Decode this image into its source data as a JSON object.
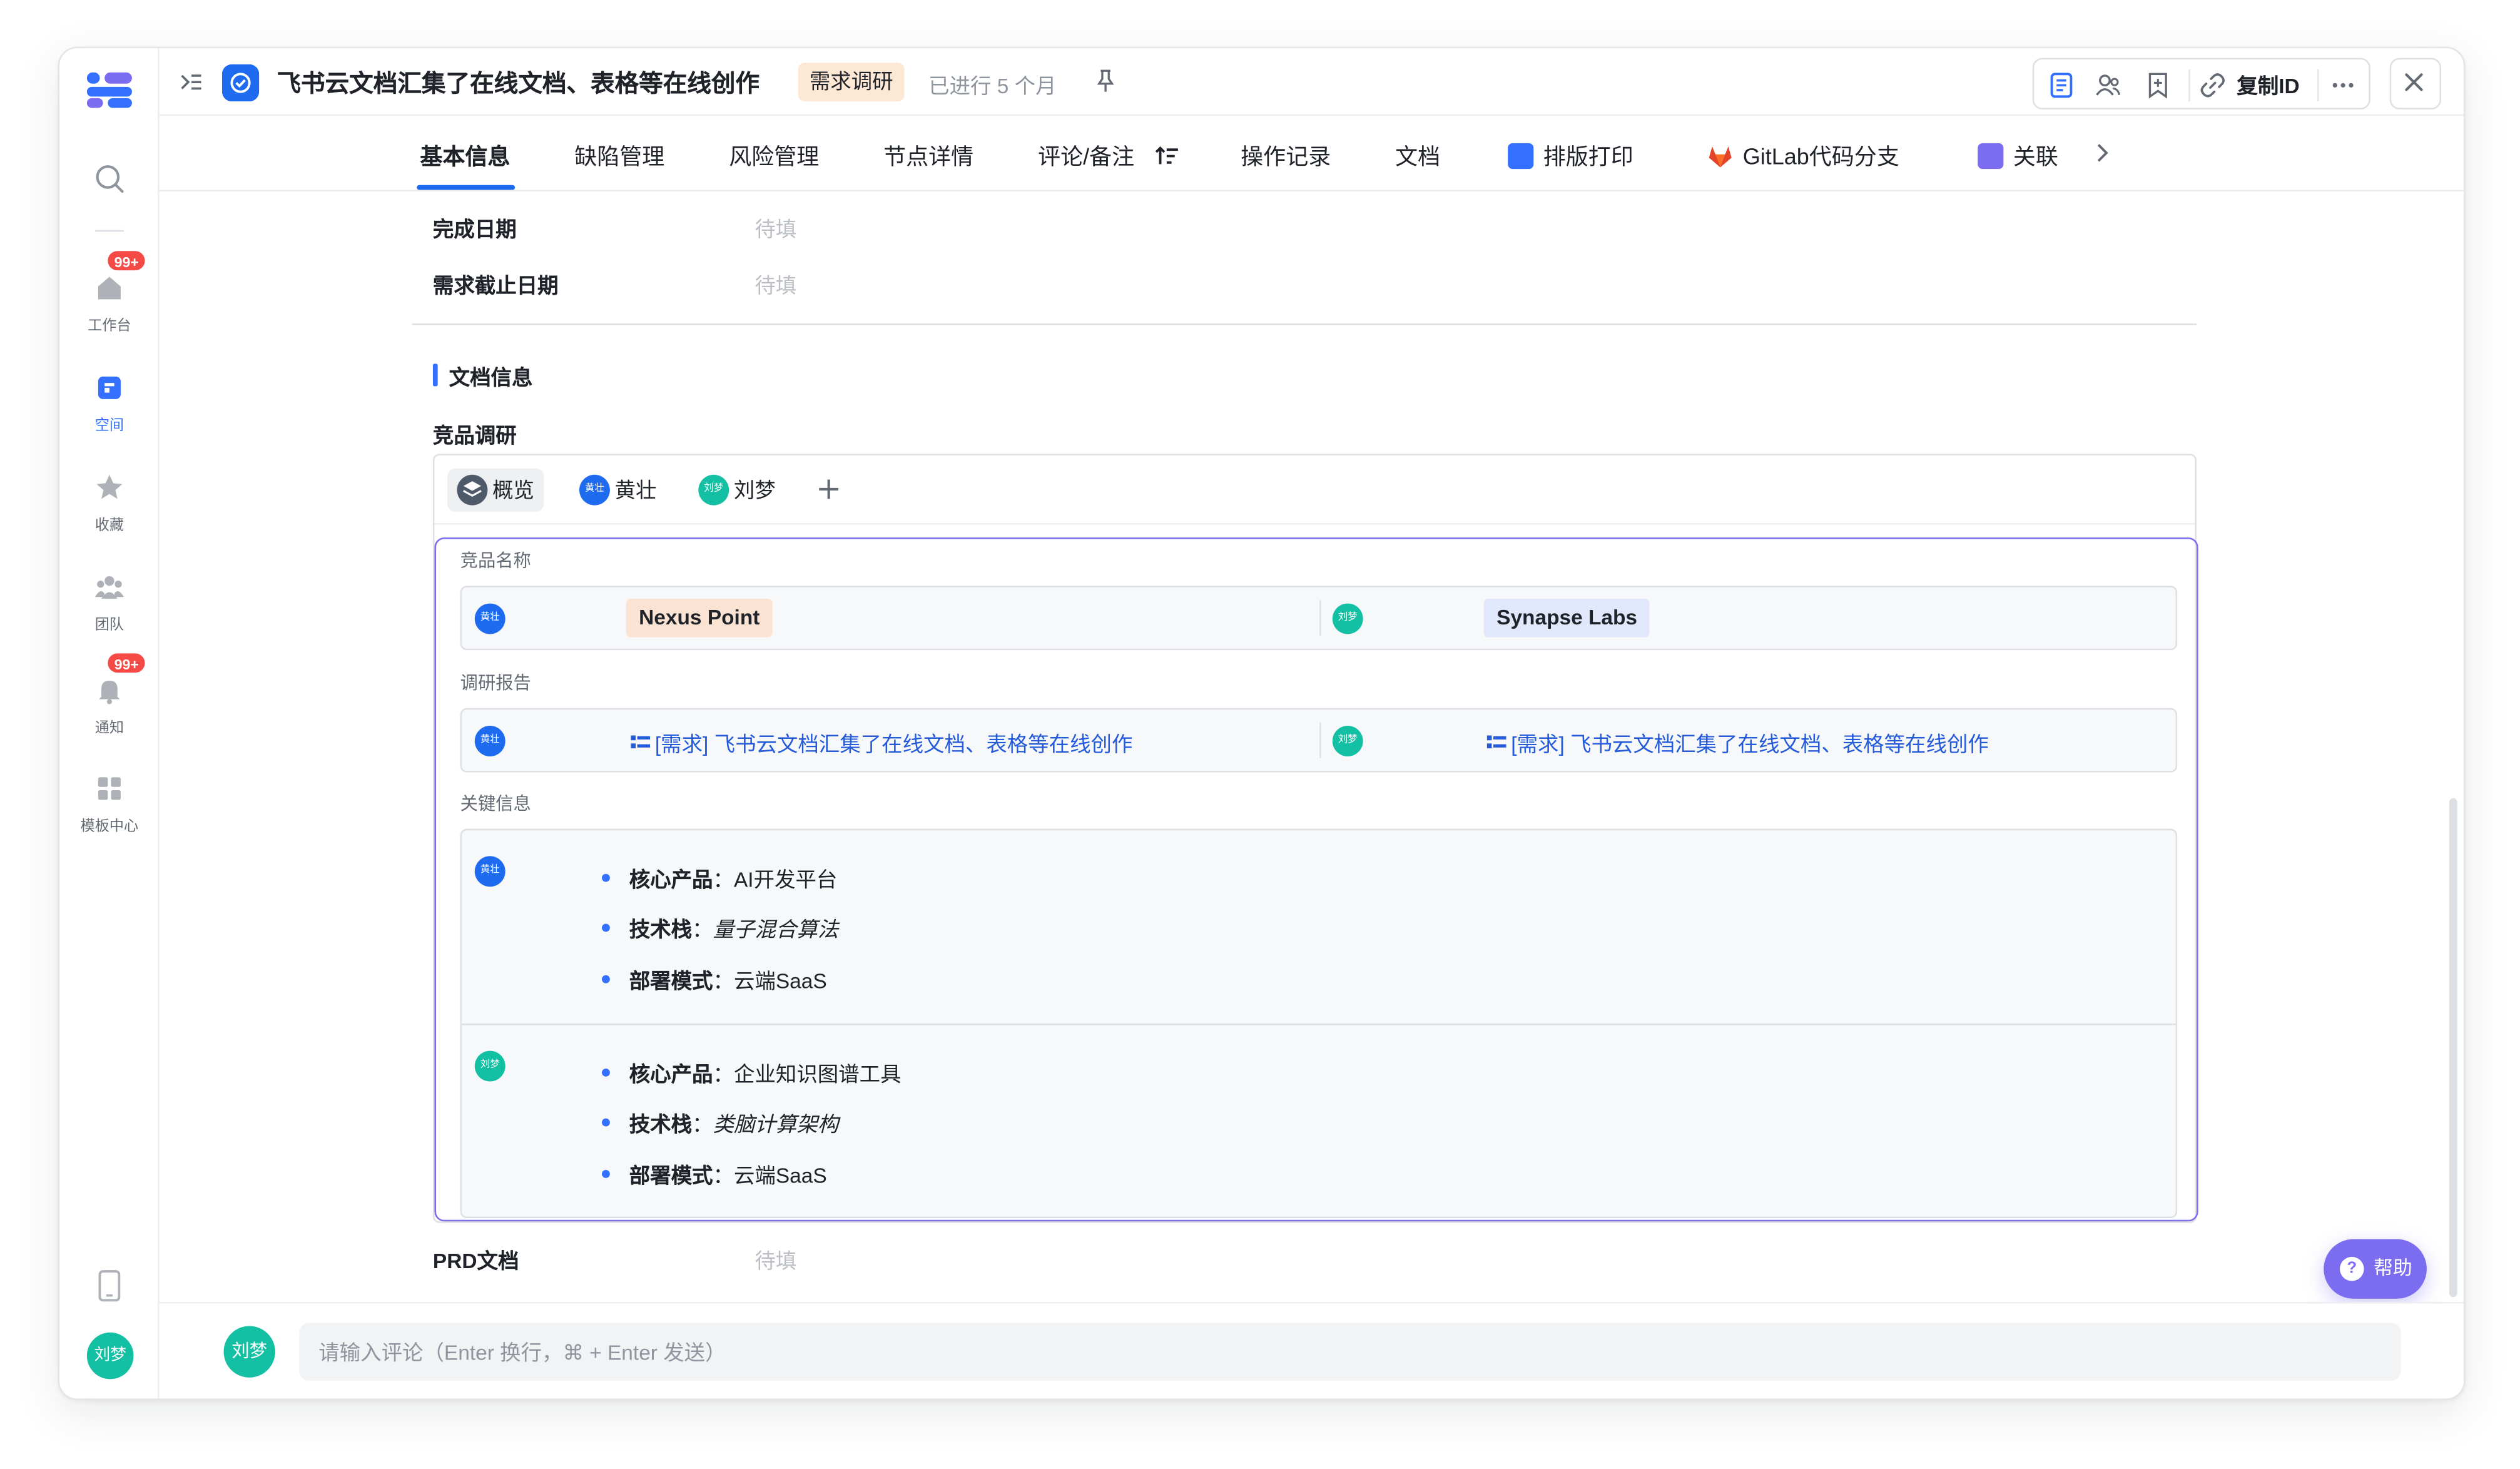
{
  "sidebar": {
    "items": [
      {
        "label": "工作台",
        "badge": "99+"
      },
      {
        "label": "空间"
      },
      {
        "label": "收藏"
      },
      {
        "label": "团队"
      },
      {
        "label": "通知",
        "badge": "99+"
      },
      {
        "label": "模板中心"
      }
    ],
    "user_avatar": "刘梦"
  },
  "header": {
    "title": "飞书云文档汇集了在线文档、表格等在线创作",
    "tag": "需求调研",
    "elapsed": "已进行 5 个月",
    "copy_id": "复制ID"
  },
  "tabs": [
    {
      "label": "基本信息"
    },
    {
      "label": "缺陷管理"
    },
    {
      "label": "风险管理"
    },
    {
      "label": "节点详情"
    },
    {
      "label": "评论/备注"
    },
    {
      "label": "操作记录"
    },
    {
      "label": "文档"
    },
    {
      "label": "排版打印"
    },
    {
      "label": "GitLab代码分支"
    },
    {
      "label": "关联‌"
    }
  ],
  "fields": {
    "completion_date": {
      "label": "完成日期",
      "value": "待填"
    },
    "req_deadline": {
      "label": "需求截止日期",
      "value": "待填"
    },
    "prd_doc": {
      "label": "PRD文档",
      "value": "待填"
    }
  },
  "doc_section": {
    "title": "文档信息",
    "subtitle": "竞品调研",
    "doc_tabs": [
      {
        "label": "概览"
      },
      {
        "label": "黄壮",
        "avatar": "黄壮"
      },
      {
        "label": "刘梦",
        "avatar": "刘梦"
      }
    ],
    "block": {
      "product_name_label": "竞品名称",
      "report_label": "调研报告",
      "key_info_label": "关键信息",
      "entries": [
        {
          "avatar": "黄壮",
          "product": "Nexus Point",
          "report": "[需求] 飞书云文档汇集了在线文档、表格等在线创作",
          "core_label": "核心产品",
          "core_value": "AI开发平台",
          "stack_label": "技术栈",
          "stack_value": "量子混合算法",
          "deploy_label": "部署模式",
          "deploy_value": "云端SaaS"
        },
        {
          "avatar": "刘梦",
          "product": "Synapse Labs",
          "report": "[需求] 飞书云文档汇集了在线文档、表格等在线创作",
          "core_label": "核心产品",
          "core_value": "企业知识图谱工具",
          "stack_label": "技术栈",
          "stack_value": "类脑计算架构",
          "deploy_label": "部署模式",
          "deploy_value": "云端SaaS"
        }
      ]
    }
  },
  "comment": {
    "avatar": "刘梦",
    "placeholder": "请输入评论（Enter 换行，⌘ + Enter 发送）"
  },
  "help": {
    "label": "帮助"
  },
  "colors": {
    "accent": "#1e6bf0",
    "sync_border": "#7b6cf0",
    "avatar_blue": "#1e6bf0",
    "avatar_teal": "#14c0a4",
    "tag_bg": "#fde8d5"
  }
}
